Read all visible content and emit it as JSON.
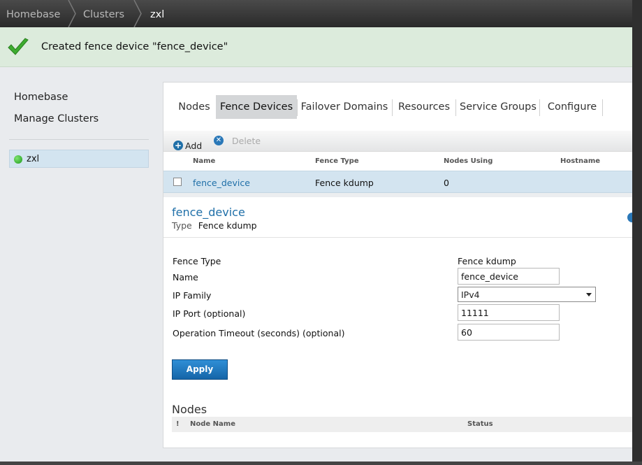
{
  "breadcrumb": {
    "items": [
      "Homebase",
      "Clusters",
      "zxl"
    ]
  },
  "notification": {
    "message": "Created fence device \"fence_device\""
  },
  "sidebar": {
    "links": [
      "Homebase",
      "Manage Clusters"
    ],
    "clusters": [
      {
        "name": "zxl",
        "status": "online"
      }
    ]
  },
  "tabs": [
    "Nodes",
    "Fence Devices",
    "Failover Domains",
    "Resources",
    "Service Groups",
    "Configure"
  ],
  "active_tab": "Fence Devices",
  "toolbar": {
    "add_label": "Add",
    "delete_label": "Delete"
  },
  "table": {
    "columns": [
      "Name",
      "Fence Type",
      "Nodes Using",
      "Hostname"
    ],
    "rows": [
      {
        "name": "fence_device",
        "fence_type": "Fence kdump",
        "nodes_using": "0",
        "hostname": ""
      }
    ]
  },
  "detail": {
    "title": "fence_device",
    "type_label": "Type",
    "type_value": "Fence kdump",
    "fields": {
      "fence_type": {
        "label": "Fence Type",
        "value": "Fence kdump"
      },
      "name": {
        "label": "Name",
        "value": "fence_device"
      },
      "ip_family": {
        "label": "IP Family",
        "value": "IPv4"
      },
      "ip_port": {
        "label": "IP Port (optional)",
        "value": "11111"
      },
      "op_timeout": {
        "label": "Operation Timeout (seconds) (optional)",
        "value": "60"
      }
    },
    "apply_label": "Apply"
  },
  "nodes_section": {
    "title": "Nodes",
    "columns": [
      "!",
      "Node Name",
      "Status"
    ]
  },
  "colors": {
    "accent": "#1f6fa8",
    "success_bg": "#dcebdc",
    "selected_row": "#d3e4f0",
    "status_online": "#2fb32f"
  }
}
